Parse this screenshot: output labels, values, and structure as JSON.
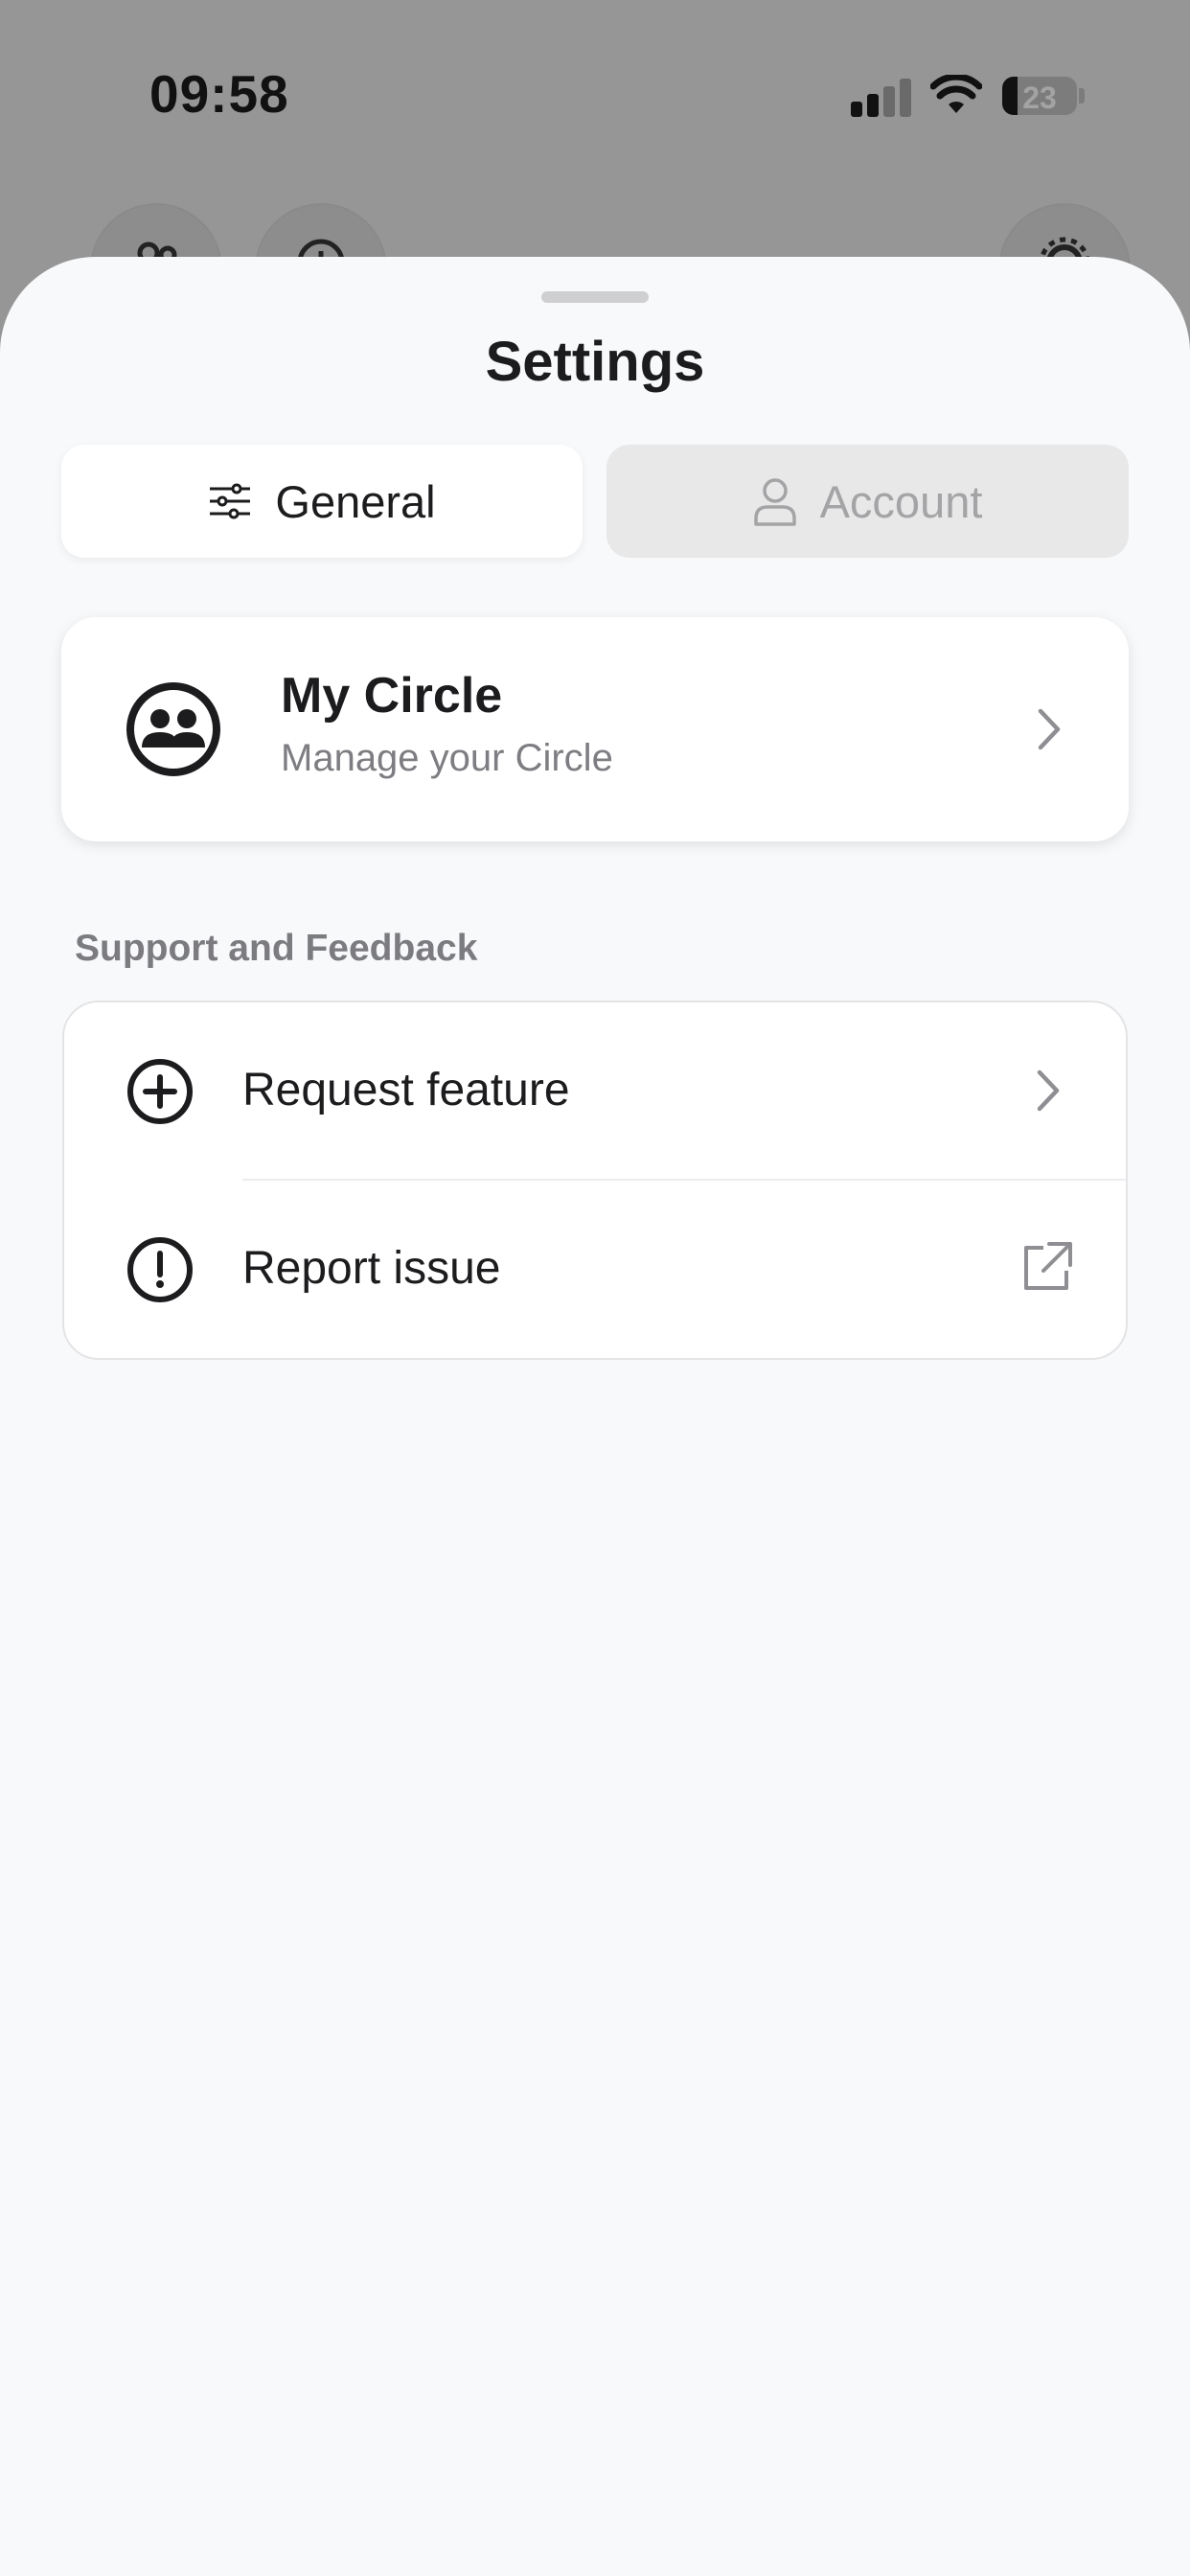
{
  "status_bar": {
    "time": "09:58",
    "battery_percent": "23",
    "cellular_icon": "cellular-signal-icon",
    "wifi_icon": "wifi-icon"
  },
  "background_app": {
    "buttons": [
      {
        "icon": "people-icon"
      },
      {
        "icon": "clock-icon"
      },
      {
        "icon": "gear-icon"
      }
    ]
  },
  "sheet": {
    "title": "Settings",
    "tabs": [
      {
        "label": "General",
        "icon": "sliders-icon",
        "selected": true
      },
      {
        "label": "Account",
        "icon": "person-icon",
        "selected": false
      }
    ],
    "my_circle": {
      "title": "My Circle",
      "subtitle": "Manage your Circle",
      "icon": "group-circle-icon",
      "trailing_icon": "chevron-right-icon"
    },
    "support_section": {
      "header": "Support and Feedback",
      "items": [
        {
          "label": "Request feature",
          "icon": "plus-circle-icon",
          "trailing_icon": "chevron-right-icon"
        },
        {
          "label": "Report issue",
          "icon": "exclamation-circle-icon",
          "trailing_icon": "external-link-icon"
        }
      ]
    }
  },
  "colors": {
    "sheet_background": "#f8f9fb",
    "card_background": "#ffffff",
    "dimmed_background": "#969696",
    "secondary_text": "#7d7d82",
    "inactive_tab": "#e8e8e9"
  }
}
